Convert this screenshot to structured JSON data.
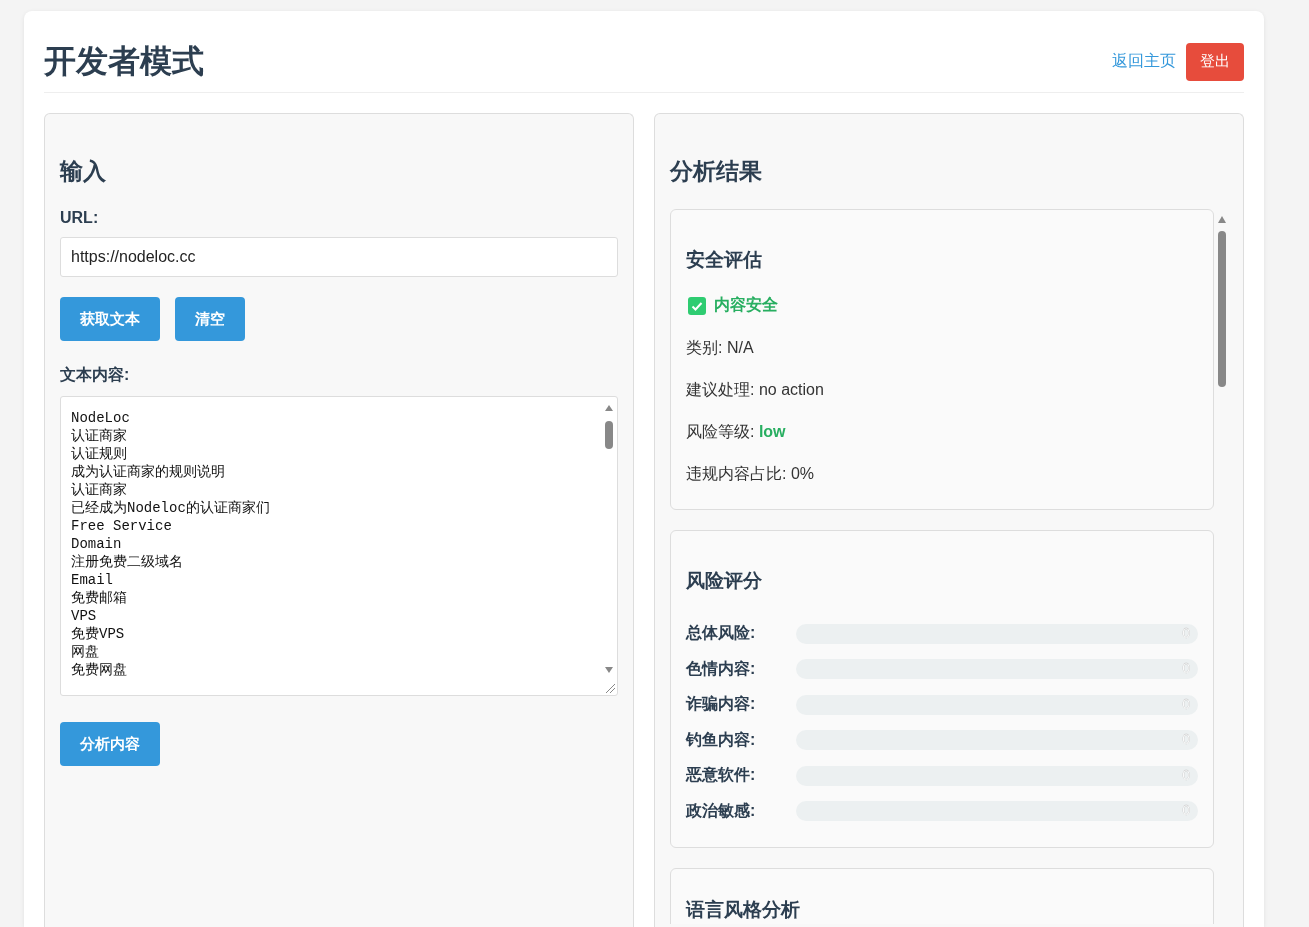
{
  "header": {
    "title": "开发者模式",
    "home_link": "返回主页",
    "logout_button": "登出"
  },
  "input_panel": {
    "title": "输入",
    "url_label": "URL:",
    "url_value": "https://nodeloc.cc",
    "buttons": [
      "获取文本",
      "清空"
    ],
    "text_label": "文本内容:",
    "text_lines": [
      "NodeLoc",
      "认证商家",
      "认证规则",
      "成为认证商家的规则说明",
      "认证商家",
      "已经成为Nodeloc的认证商家们",
      "Free Service",
      "Domain",
      "注册免费二级域名",
      "Email",
      "免费邮箱",
      "VPS",
      "免费VPS",
      "网盘",
      "免费网盘"
    ],
    "analyze_button": "分析内容"
  },
  "result_panel": {
    "title": "分析结果",
    "safety": {
      "title": "安全评估",
      "safe": true,
      "status": "内容安全",
      "category_label": "类别:",
      "category": "N/A",
      "action_label": "建议处理:",
      "action": "no action",
      "risk_label": "风险等级:",
      "risk_level": "low",
      "ratio_label": "违规内容占比:",
      "ratio": "0%"
    },
    "risk_scores": {
      "title": "风险评分",
      "items": [
        {
          "label": "总体风险:",
          "level": 0,
          "value": "0"
        },
        {
          "label": "色情内容:",
          "level": 0,
          "value": "0"
        },
        {
          "label": "诈骗内容:",
          "level": 0,
          "value": "0"
        },
        {
          "label": "钓鱼内容:",
          "level": 0,
          "value": "0"
        },
        {
          "label": "恶意软件:",
          "level": 0,
          "value": "0"
        },
        {
          "label": "政治敏感:",
          "level": 0,
          "value": "0"
        }
      ]
    },
    "style": {
      "title": "语言风格分析"
    }
  }
}
